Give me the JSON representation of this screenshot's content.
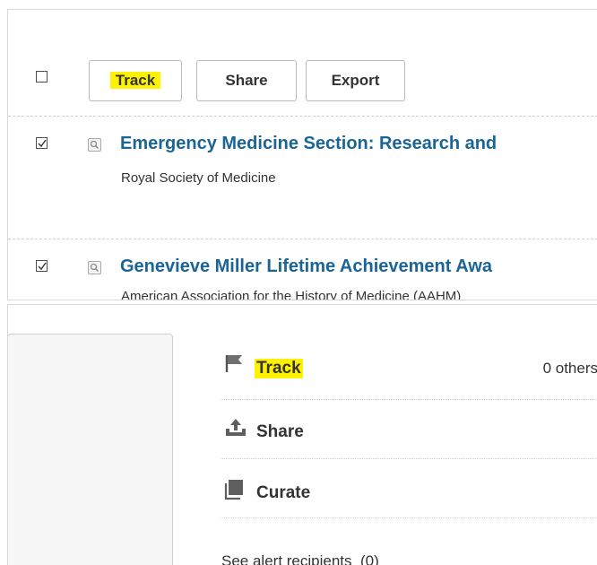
{
  "toolbar": {
    "select_all_checked": false,
    "track_label": "Track",
    "share_label": "Share",
    "export_label": "Export"
  },
  "results": [
    {
      "checked": true,
      "title": "Emergency Medicine Section: Research and",
      "org": "Royal Society of Medicine"
    },
    {
      "checked": true,
      "title": "Genevieve Miller Lifetime Achievement Awa",
      "org": "American Association for the History of Medicine (AAHM)"
    }
  ],
  "actions": {
    "track_label": "Track",
    "track_others": "0 others",
    "share_label": "Share",
    "curate_label": "Curate",
    "recipients_label": "See alert recipients",
    "recipients_count": "(0)"
  },
  "colors": {
    "highlight": "#fff200",
    "link": "#1a6496",
    "text": "#333333"
  },
  "icons": [
    "checkbox-icon",
    "checkmark-icon",
    "magnifier-icon",
    "flag-icon",
    "upload-icon",
    "stack-icon"
  ]
}
